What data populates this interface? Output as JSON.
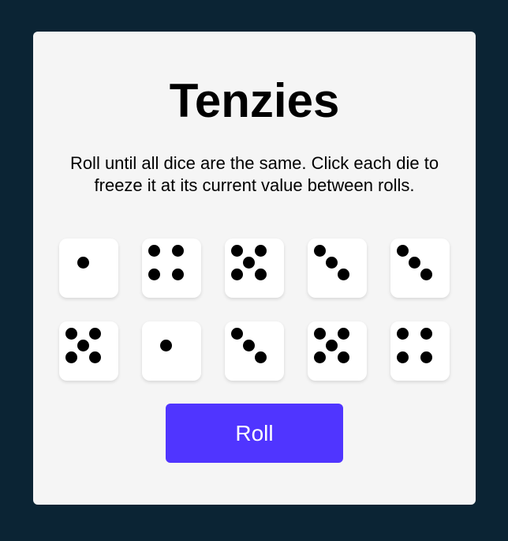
{
  "game": {
    "title": "Tenzies",
    "instructions": "Roll until all dice are the same. Click each die to freeze it at its current value between rolls.",
    "roll_label": "Roll"
  },
  "dice": [
    {
      "value": 1,
      "held": false
    },
    {
      "value": 4,
      "held": false
    },
    {
      "value": 5,
      "held": false
    },
    {
      "value": 3,
      "held": false
    },
    {
      "value": 3,
      "held": false
    },
    {
      "value": 5,
      "held": false
    },
    {
      "value": 1,
      "held": false
    },
    {
      "value": 3,
      "held": false
    },
    {
      "value": 5,
      "held": false
    },
    {
      "value": 4,
      "held": false
    }
  ],
  "colors": {
    "background": "#0b2434",
    "card": "#f5f5f5",
    "die": "#ffffff",
    "pip": "#000000",
    "button": "#5035ff"
  }
}
